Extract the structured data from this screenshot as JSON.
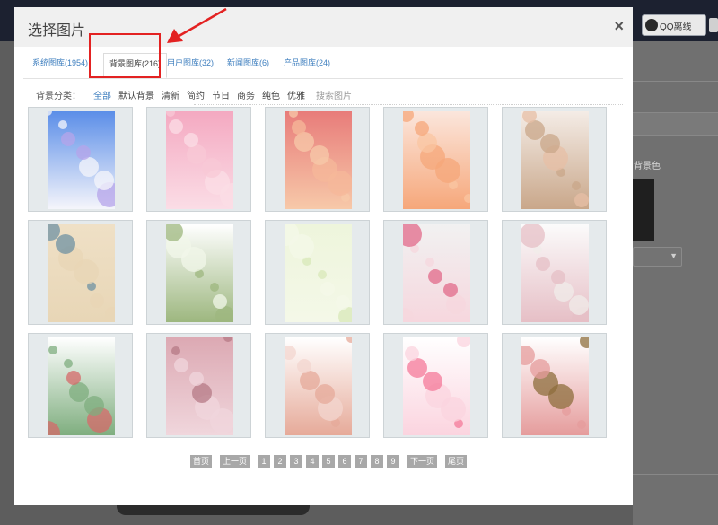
{
  "modal": {
    "title": "选择图片",
    "close_label": "×"
  },
  "tabs": [
    {
      "label": "系统图库(1954)",
      "active": false
    },
    {
      "label": "背景图库(216)",
      "active": true
    },
    {
      "label": "用户图库(32)",
      "active": false
    },
    {
      "label": "新闻图库(6)",
      "active": false
    },
    {
      "label": "产品图库(24)",
      "active": false
    }
  ],
  "filters": {
    "label": "背景分类：",
    "items": [
      "全部",
      "默认背景",
      "清新",
      "简约",
      "节日",
      "商务",
      "纯色",
      "优雅"
    ],
    "active": "全部",
    "search_label": "搜索图片"
  },
  "images": [
    {
      "name": "blue-bokeh",
      "colors": [
        "#5b8ee8",
        "#b6a4ea",
        "#f5f5fb"
      ]
    },
    {
      "name": "pink-flowers",
      "colors": [
        "#f4a9c1",
        "#f8c8d6",
        "#fbdde6"
      ]
    },
    {
      "name": "pink-sequins",
      "colors": [
        "#e87c7a",
        "#f6b89a",
        "#f7c9a9"
      ]
    },
    {
      "name": "peach-gradient",
      "colors": [
        "#fbe6dc",
        "#f9c5a2",
        "#f6a77a"
      ]
    },
    {
      "name": "floral-pattern",
      "colors": [
        "#f4ece6",
        "#e7bfa6",
        "#c9a78a"
      ]
    },
    {
      "name": "blue-daisy-pattern",
      "colors": [
        "#efe0c6",
        "#6f92a3",
        "#e8d6b6"
      ]
    },
    {
      "name": "white-blossom-branch",
      "colors": [
        "#ffffff",
        "#f1f7ea",
        "#9db77f"
      ]
    },
    {
      "name": "green-texture",
      "colors": [
        "#eef5dc",
        "#d8e8b8",
        "#f4f8e8"
      ]
    },
    {
      "name": "pink-peach-blossom",
      "colors": [
        "#f1f1f1",
        "#e26a8a",
        "#f6d7de"
      ]
    },
    {
      "name": "white-cherry-blossom",
      "colors": [
        "#fbfbfb",
        "#f0ecea",
        "#e6bfc6"
      ]
    },
    {
      "name": "small-floral",
      "colors": [
        "#ffffff",
        "#d66a6a",
        "#7fae7f"
      ]
    },
    {
      "name": "pink-roses",
      "colors": [
        "#dca9b3",
        "#b57a86",
        "#f0d6dc"
      ]
    },
    {
      "name": "pink-leaf-art",
      "colors": [
        "#ffffff",
        "#f3d6cf",
        "#e6aa99"
      ]
    },
    {
      "name": "pink-lily",
      "colors": [
        "#ffffff",
        "#f47a9a",
        "#fbd4df"
      ]
    },
    {
      "name": "tree-branch",
      "colors": [
        "#ffffff",
        "#8e6e3c",
        "#e59c9c"
      ]
    }
  ],
  "pagination": {
    "first": "首页",
    "prev": "上一页",
    "pages": [
      "1",
      "2",
      "3",
      "4",
      "5",
      "6",
      "7",
      "8",
      "9"
    ],
    "next": "下一页",
    "last": "尾页"
  },
  "background": {
    "qq_label": "QQ离线",
    "right_label": "背景色"
  },
  "accent_colors": {
    "link": "#3f7fbf",
    "highlight": "#e32222"
  }
}
